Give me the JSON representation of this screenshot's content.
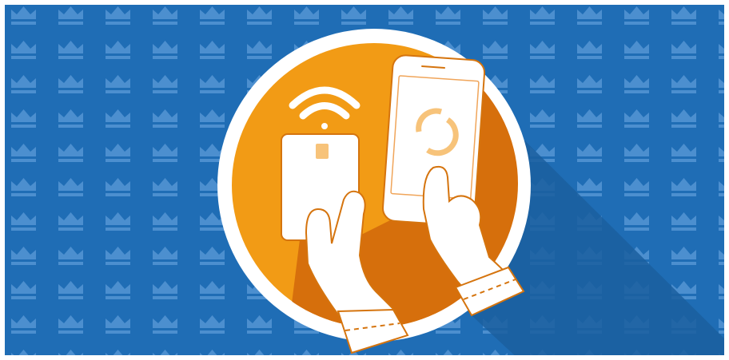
{
  "illustration": {
    "subject": "hands-holding-card-and-phone",
    "colors": {
      "background_blue": "#1f6db5",
      "pattern_crown": "#4c8fcf",
      "long_shadow": "#1b5f9f",
      "disc_white": "#ffffff",
      "disc_orange": "#f29b15",
      "disc_orange_shadow": "#d66f0c",
      "outline_orange": "#d5740e",
      "accent_light_orange": "#f7c37a"
    },
    "icons": [
      "crown-pattern",
      "wifi-icon",
      "card-chip-icon",
      "loading-spinner-icon"
    ]
  }
}
